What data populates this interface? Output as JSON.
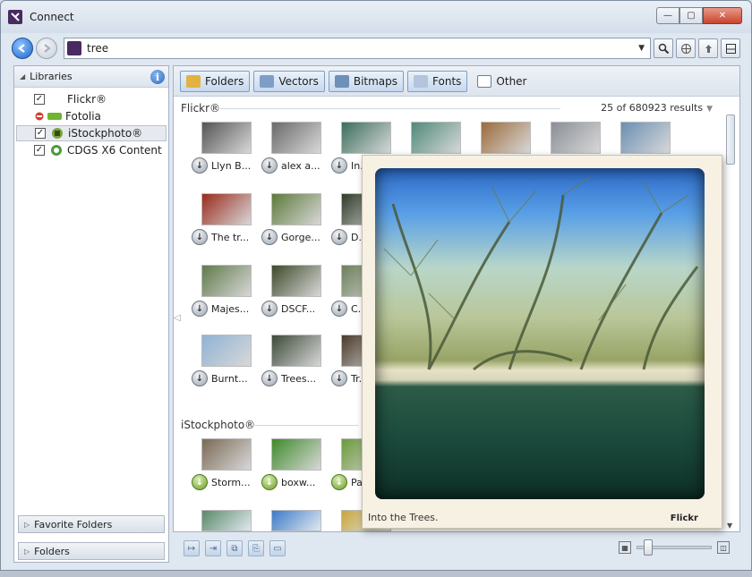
{
  "window": {
    "title": "Connect",
    "minimize": "—",
    "maximize": "▢",
    "close": "✕"
  },
  "toolbar": {
    "search_value": "tree",
    "icons": [
      "back-icon",
      "forward-icon",
      "search-icon",
      "web-icon",
      "upload-icon",
      "panel-icon"
    ]
  },
  "sidebar": {
    "header": "Libraries",
    "libraries": [
      {
        "label": "Flickr®",
        "checked": true,
        "icon": "none"
      },
      {
        "label": "Fotolia",
        "checked": false,
        "icon": "fotolia-icon"
      },
      {
        "label": "iStockphoto®",
        "checked": true,
        "icon": "istockphoto-icon"
      },
      {
        "label": "CDGS X6 Content",
        "checked": true,
        "icon": "corel-content-icon"
      }
    ],
    "favorite_folders": "Favorite Folders",
    "folders": "Folders"
  },
  "tabs": [
    {
      "label": "Folders",
      "color": "#e2b344"
    },
    {
      "label": "Vectors",
      "color": "#7d9fc6"
    },
    {
      "label": "Bitmaps",
      "color": "#6d8fb8"
    },
    {
      "label": "Fonts",
      "color": "#b3c4dc"
    },
    {
      "label": "Other",
      "color": "#ffffff"
    }
  ],
  "sections": {
    "flickr": "Flickr®",
    "istock": "iStockphoto®",
    "results": "25 of 680923 results"
  },
  "flickr_items": [
    {
      "label": "Llyn B...",
      "color": "#555555"
    },
    {
      "label": "alex a...",
      "color": "#6a6a6a"
    },
    {
      "label": "In...",
      "color": "#3b6f5c"
    },
    {
      "label": "",
      "color": "#4f8a7a"
    },
    {
      "label": "",
      "color": "#9c6a3b"
    },
    {
      "label": "",
      "color": "#8a8f96"
    },
    {
      "label": "",
      "color": "#6a8fb3"
    },
    {
      "label": "The tr...",
      "color": "#9a2a1c"
    },
    {
      "label": "Gorge...",
      "color": "#5d7a3a"
    },
    {
      "label": "D...",
      "color": "#2f3b28"
    },
    {
      "label": "Majes...",
      "color": "#5f7a4a"
    },
    {
      "label": "DSCF...",
      "color": "#3f4a2a"
    },
    {
      "label": "C...",
      "color": "#6c7f5a"
    },
    {
      "label": "Burnt...",
      "color": "#8fb3d4"
    },
    {
      "label": "Trees...",
      "color": "#3d4a3a"
    },
    {
      "label": "Tr...",
      "color": "#4a3a2a"
    }
  ],
  "istock_items": [
    {
      "label": "Storm...",
      "color": "#7a6a55"
    },
    {
      "label": "boxw...",
      "color": "#3f8a2a"
    },
    {
      "label": "Pa...",
      "color": "#6a9a3a"
    }
  ],
  "istock_row2": [
    {
      "color": "#5a8a6a"
    },
    {
      "color": "#3d7ac8"
    },
    {
      "color": "#c9a53a"
    }
  ],
  "preview": {
    "caption": "Into the Trees.",
    "source": "Flickr"
  },
  "zoom": {
    "level": 0.1
  }
}
